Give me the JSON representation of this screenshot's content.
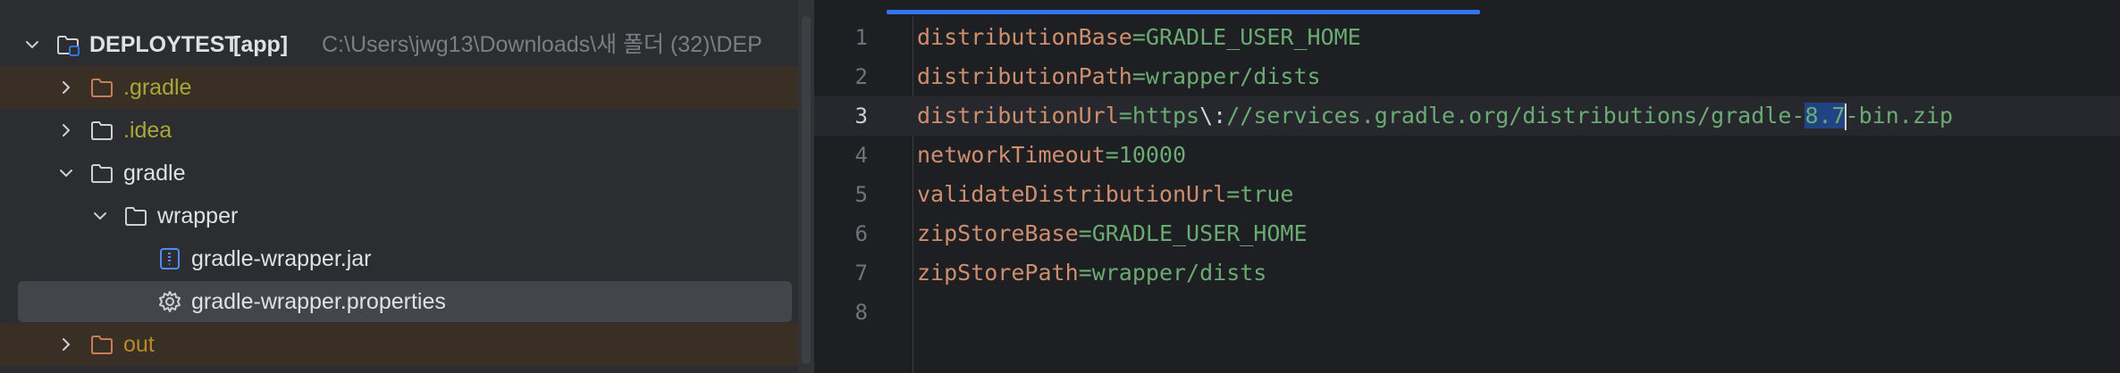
{
  "project_tree": {
    "root": {
      "name": "DEPLOYTEST",
      "module": "[app]",
      "path": "C:\\Users\\jwg13\\Downloads\\새 폴더 (32)\\DEP"
    },
    "items": [
      {
        "label": ".gradle"
      },
      {
        "label": ".idea"
      },
      {
        "label": "gradle"
      },
      {
        "label": "wrapper"
      },
      {
        "label": "gradle-wrapper.jar"
      },
      {
        "label": "gradle-wrapper.properties"
      },
      {
        "label": "out"
      }
    ]
  },
  "editor": {
    "line_numbers": [
      "1",
      "2",
      "3",
      "4",
      "5",
      "6",
      "7",
      "8"
    ],
    "lines": [
      {
        "key": "distributionBase",
        "eq": "=",
        "value": "GRADLE_USER_HOME"
      },
      {
        "key": "distributionPath",
        "eq": "=",
        "value": "wrapper/dists"
      },
      {
        "key": "distributionUrl",
        "eq": "=",
        "value_pre": "https",
        "escape": "\\:",
        "value_mid": "//services.gradle.org/distributions/gradle-",
        "selected": "8.7",
        "value_post": "-bin.zip"
      },
      {
        "key": "networkTimeout",
        "eq": "=",
        "value": "10000"
      },
      {
        "key": "validateDistributionUrl",
        "eq": "=",
        "value": "true"
      },
      {
        "key": "zipStoreBase",
        "eq": "=",
        "value": "GRADLE_USER_HOME"
      },
      {
        "key": "zipStorePath",
        "eq": "=",
        "value": "wrapper/dists"
      }
    ]
  },
  "colors": {
    "panel_bg": "#2b2d30",
    "editor_bg": "#1e1f22",
    "key": "#cf8e6d",
    "value": "#6aab73",
    "selection": "#214283",
    "accent": "#3574f0"
  }
}
